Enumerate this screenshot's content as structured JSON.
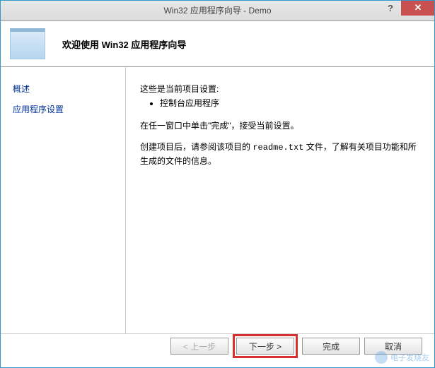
{
  "titlebar": {
    "title": "Win32 应用程序向导 - Demo",
    "help": "?",
    "close": "✕"
  },
  "banner": {
    "title": "欢迎使用 Win32 应用程序向导"
  },
  "sidebar": {
    "items": [
      {
        "label": "概述"
      },
      {
        "label": "应用程序设置"
      }
    ]
  },
  "main": {
    "settings_intro": "这些是当前项目设置:",
    "settings_items": [
      "控制台应用程序"
    ],
    "finish_instruction": "在任一窗口中单击\"完成\"，接受当前设置。",
    "readme_note_pre": "创建项目后，请参阅该项目的 ",
    "readme_file": "readme.txt",
    "readme_note_post": " 文件，了解有关项目功能和所生成的文件的信息。"
  },
  "buttons": {
    "prev": "< 上一步",
    "next": "下一步 >",
    "finish": "完成",
    "cancel": "取消"
  },
  "watermark": {
    "text": "电子发烧友"
  }
}
